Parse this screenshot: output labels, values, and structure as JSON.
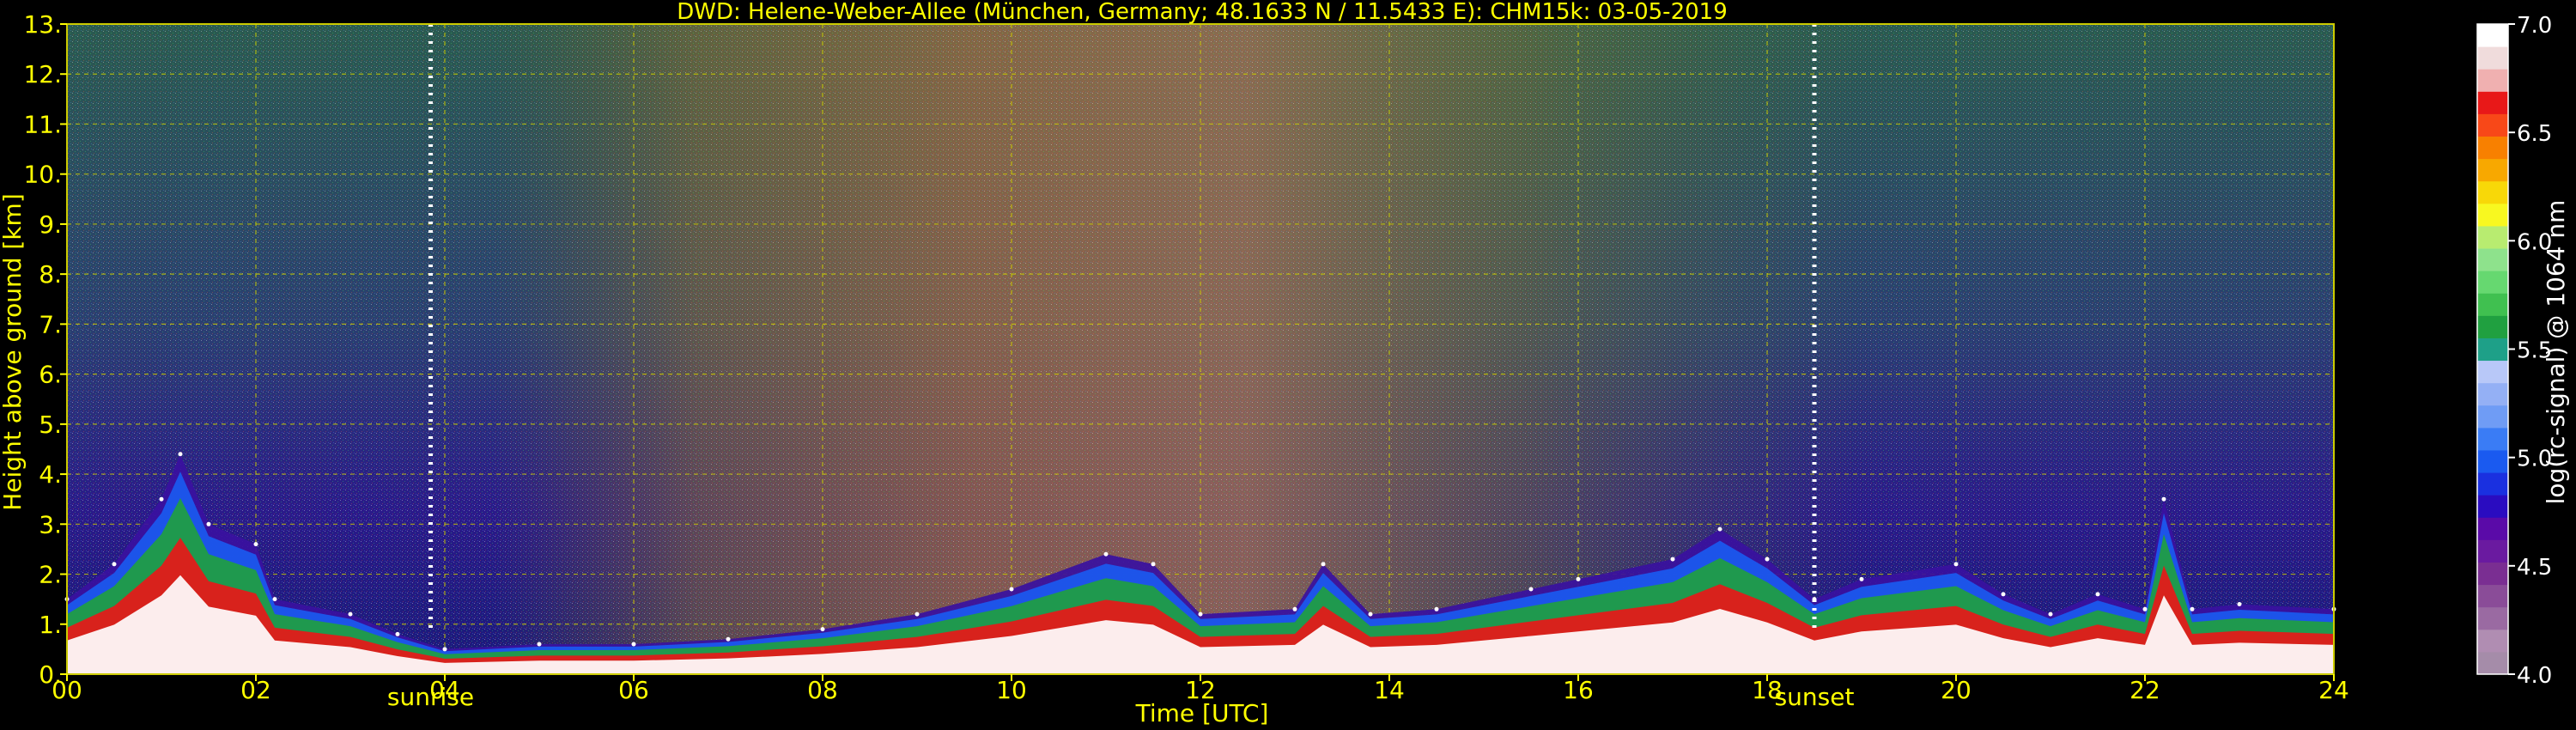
{
  "chart_data": {
    "type": "heatmap",
    "title": "DWD: Helene-Weber-Allee (München, Germany; 48.1633 N / 11.5433 E):    CHM15k: 03-05-2019",
    "xlabel": "Time [UTC]",
    "ylabel": "Height above ground [km]",
    "xlim": [
      0,
      24
    ],
    "ylim": [
      0,
      13
    ],
    "x_ticks": [
      "00",
      "02",
      "04",
      "06",
      "08",
      "10",
      "12",
      "14",
      "16",
      "18",
      "20",
      "22",
      "24"
    ],
    "y_ticks": [
      "0.",
      "1.",
      "2.",
      "3.",
      "4.",
      "5.",
      "6.",
      "7.",
      "8.",
      "9.",
      "10.",
      "11.",
      "12.",
      "13."
    ],
    "grid": true,
    "annotations": [
      {
        "label": "sunrise",
        "x": 3.85
      },
      {
        "label": "sunset",
        "x": 18.5
      }
    ],
    "colorbar": {
      "label": "log(rc-signal) @ 1064 nm",
      "range": [
        4.0,
        7.0
      ],
      "ticks": [
        "4.0",
        "4.5",
        "5.0",
        "5.5",
        "6.0",
        "6.5",
        "7.0"
      ],
      "colors": [
        "#a58ca9",
        "#b08db2",
        "#9a6aa2",
        "#8a4c98",
        "#7a2e92",
        "#6a1aa0",
        "#5a0aa8",
        "#2a0cc0",
        "#1a30e0",
        "#1a5af0",
        "#3a7cf5",
        "#6f9cf5",
        "#94b0f5",
        "#b8c8f8",
        "#1ea088",
        "#20a040",
        "#40c050",
        "#66d870",
        "#8ee28c",
        "#b8ec70",
        "#f8f820",
        "#f8d808",
        "#f8a800",
        "#f88000",
        "#f84818",
        "#e81818",
        "#f0b0b0",
        "#f0dcdc",
        "#ffffff"
      ]
    },
    "cloud_base_top_km": [
      [
        0,
        1.5
      ],
      [
        0.5,
        2.2
      ],
      [
        1,
        3.5
      ],
      [
        1.2,
        4.4
      ],
      [
        1.5,
        3.0
      ],
      [
        2,
        2.6
      ],
      [
        2.2,
        1.5
      ],
      [
        3,
        1.2
      ],
      [
        3.5,
        0.8
      ],
      [
        4,
        0.5
      ],
      [
        5,
        0.6
      ],
      [
        6,
        0.6
      ],
      [
        7,
        0.7
      ],
      [
        8,
        0.9
      ],
      [
        9,
        1.2
      ],
      [
        10,
        1.7
      ],
      [
        11,
        2.4
      ],
      [
        11.5,
        2.2
      ],
      [
        12,
        1.2
      ],
      [
        13,
        1.3
      ],
      [
        13.3,
        2.2
      ],
      [
        13.8,
        1.2
      ],
      [
        14.5,
        1.3
      ],
      [
        15.5,
        1.7
      ],
      [
        16,
        1.9
      ],
      [
        17,
        2.3
      ],
      [
        17.5,
        2.9
      ],
      [
        18,
        2.3
      ],
      [
        18.5,
        1.5
      ],
      [
        19,
        1.9
      ],
      [
        20,
        2.2
      ],
      [
        20.5,
        1.6
      ],
      [
        21,
        1.2
      ],
      [
        21.5,
        1.6
      ],
      [
        22,
        1.3
      ],
      [
        22.2,
        3.5
      ],
      [
        22.5,
        1.3
      ],
      [
        23,
        1.4
      ],
      [
        24,
        1.3
      ]
    ]
  }
}
